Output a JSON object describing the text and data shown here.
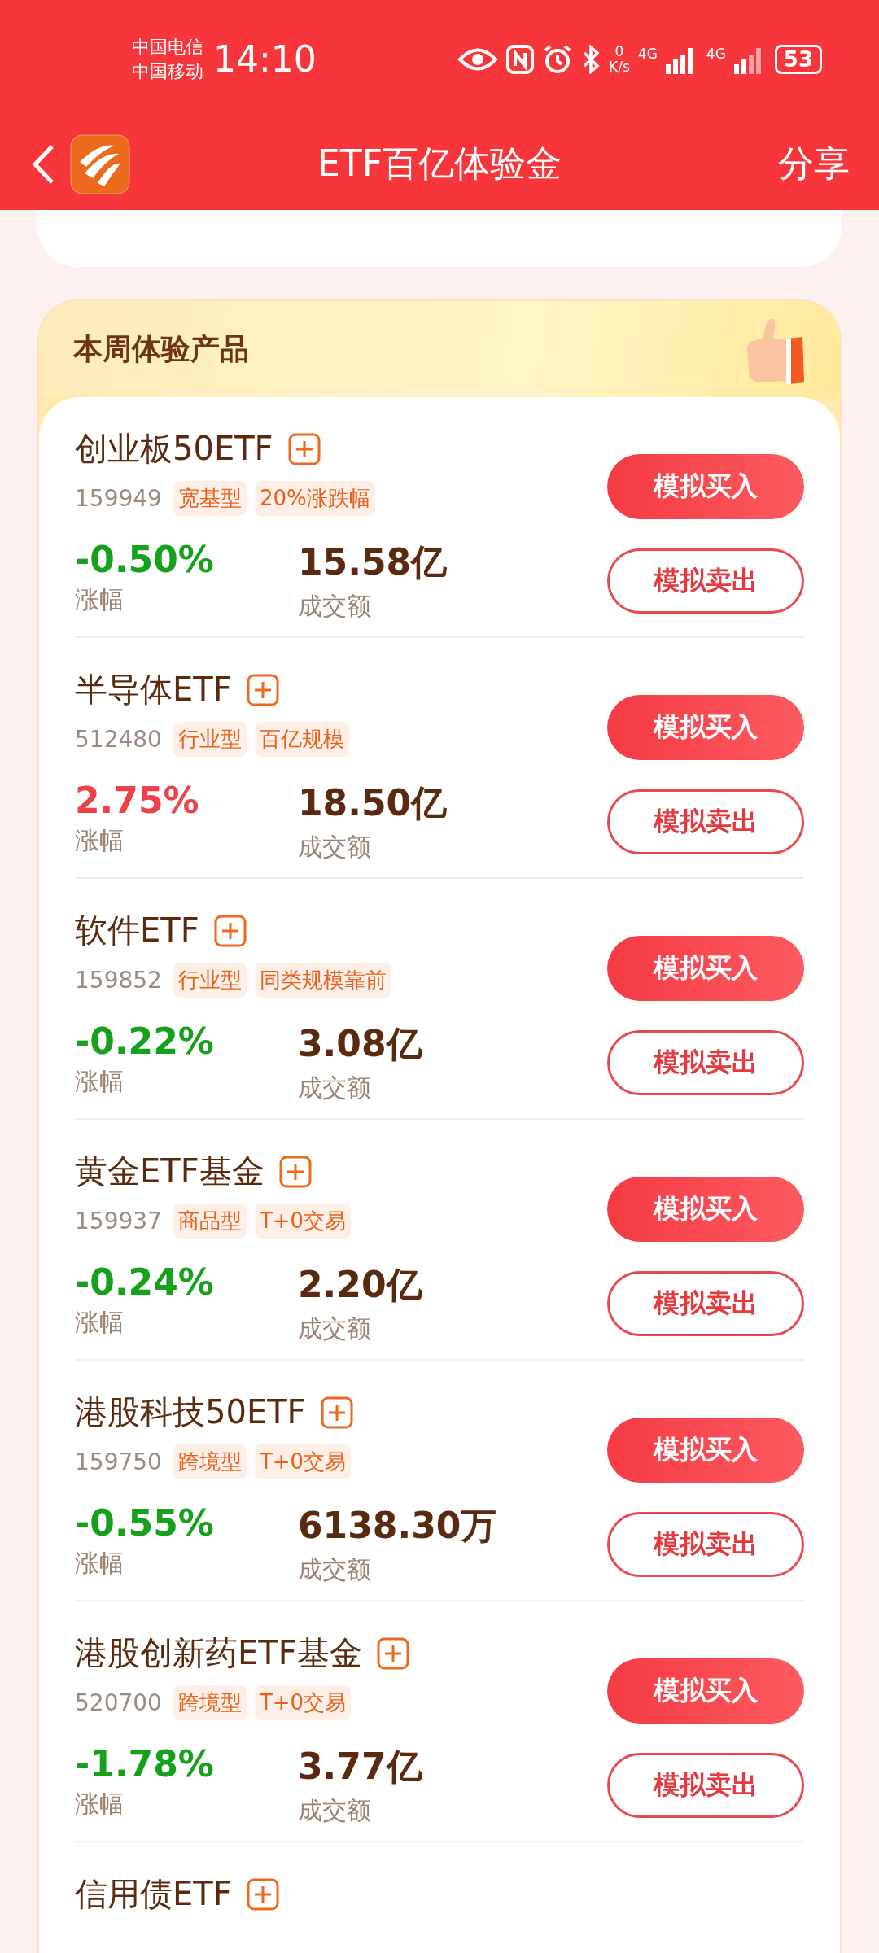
{
  "status_bar": {
    "carriers": [
      "中国电信",
      "中国移动"
    ],
    "time": "14:10",
    "net_speed_value": "0",
    "net_speed_unit": "K/s",
    "network_1": "4G",
    "network_2": "4G",
    "battery": "53"
  },
  "header": {
    "title": "ETF百亿体验金",
    "share": "分享"
  },
  "section": {
    "title": "本周体验产品"
  },
  "products": [
    {
      "name": "创业板50ETF",
      "code": "159949",
      "tags": [
        "宽基型",
        "20%涨跌幅"
      ],
      "change": "-0.50%",
      "rising": false,
      "change_label": "涨幅",
      "turnover": "15.58亿",
      "turnover_label": "成交额",
      "buy": "模拟买入",
      "sell": "模拟卖出"
    },
    {
      "name": "半导体ETF",
      "code": "512480",
      "tags": [
        "行业型",
        "百亿规模"
      ],
      "change": "2.75%",
      "rising": true,
      "change_label": "涨幅",
      "turnover": "18.50亿",
      "turnover_label": "成交额",
      "buy": "模拟买入",
      "sell": "模拟卖出"
    },
    {
      "name": "软件ETF",
      "code": "159852",
      "tags": [
        "行业型",
        "同类规模靠前"
      ],
      "change": "-0.22%",
      "rising": false,
      "change_label": "涨幅",
      "turnover": "3.08亿",
      "turnover_label": "成交额",
      "buy": "模拟买入",
      "sell": "模拟卖出"
    },
    {
      "name": "黄金ETF基金",
      "code": "159937",
      "tags": [
        "商品型",
        "T+0交易"
      ],
      "change": "-0.24%",
      "rising": false,
      "change_label": "涨幅",
      "turnover": "2.20亿",
      "turnover_label": "成交额",
      "buy": "模拟买入",
      "sell": "模拟卖出"
    },
    {
      "name": "港股科技50ETF",
      "code": "159750",
      "tags": [
        "跨境型",
        "T+0交易"
      ],
      "change": "-0.55%",
      "rising": false,
      "change_label": "涨幅",
      "turnover": "6138.30万",
      "turnover_label": "成交额",
      "buy": "模拟买入",
      "sell": "模拟卖出"
    },
    {
      "name": "港股创新药ETF基金",
      "code": "520700",
      "tags": [
        "跨境型",
        "T+0交易"
      ],
      "change": "-1.78%",
      "rising": false,
      "change_label": "涨幅",
      "turnover": "3.77亿",
      "turnover_label": "成交额",
      "buy": "模拟买入",
      "sell": "模拟卖出"
    },
    {
      "name": "信用债ETF"
    }
  ]
}
